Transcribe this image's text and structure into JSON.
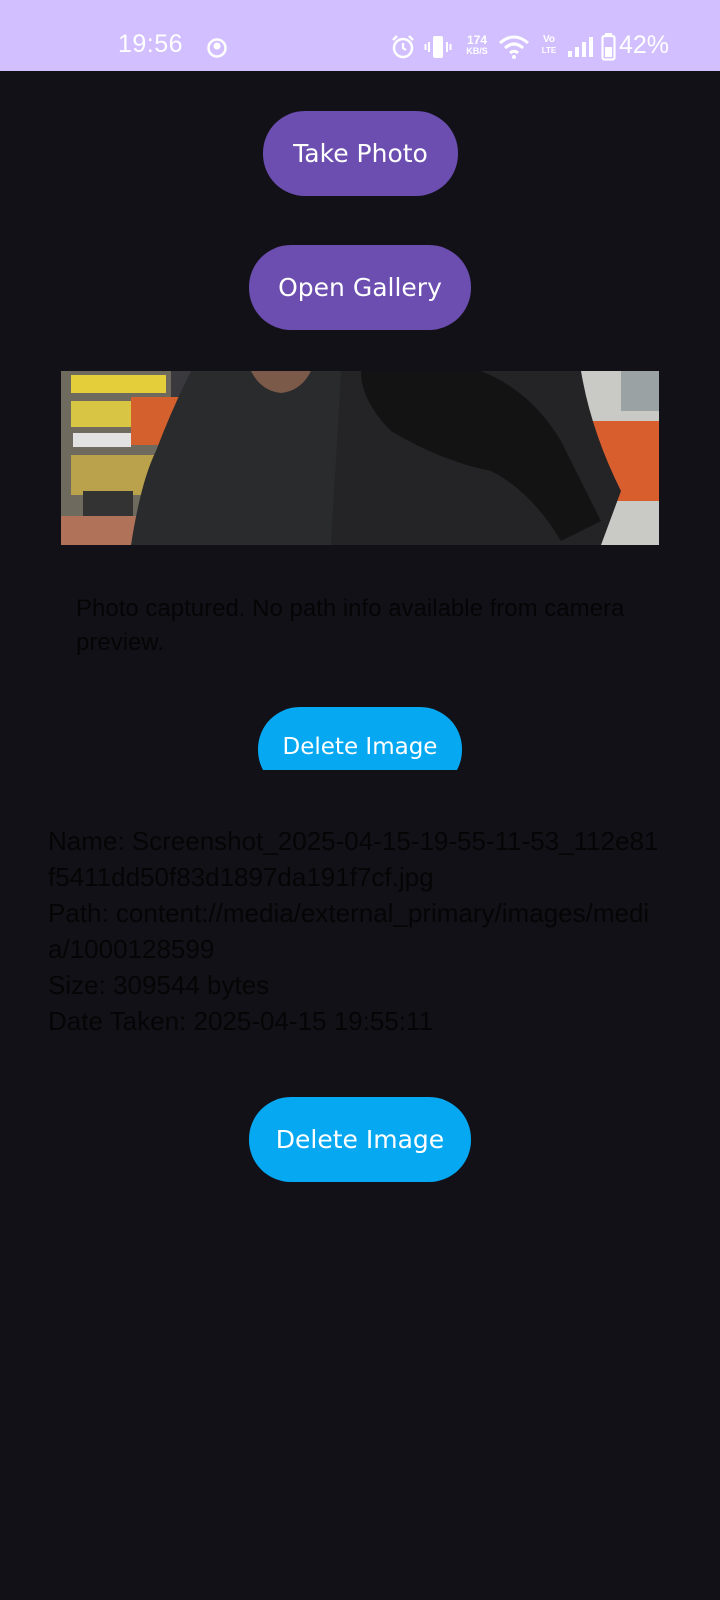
{
  "status_bar": {
    "time": "19:56",
    "net_speed_value": "174",
    "net_speed_unit": "KB/S",
    "volte_top": "Vo",
    "volte_bottom": "LTE",
    "battery": "42%",
    "icons": [
      "notification-icon",
      "alarm-icon",
      "vibrate-icon",
      "wifi-icon",
      "signal-icon",
      "battery-icon"
    ]
  },
  "buttons": {
    "take_photo": "Take Photo",
    "open_gallery": "Open Gallery",
    "delete_image_clipped": "Delete Image",
    "delete_image": "Delete Image"
  },
  "photo_status": "Photo captured. No path info available from camera preview.",
  "image_info": {
    "name": "Name: Screenshot_2025-04-15-19-55-11-53_112e81f5411dd50f83d1897da191f7cf.jpg",
    "path": "Path: content://media/external_primary/images/media/1000128599",
    "size": "Size: 309544 bytes",
    "date_taken": "Date Taken: 2025-04-15 19:55:11"
  },
  "colors": {
    "background": "#131118",
    "status_bar": "#d2bfff",
    "primary_button": "#6b4eb0",
    "delete_button": "#06a8f2"
  }
}
